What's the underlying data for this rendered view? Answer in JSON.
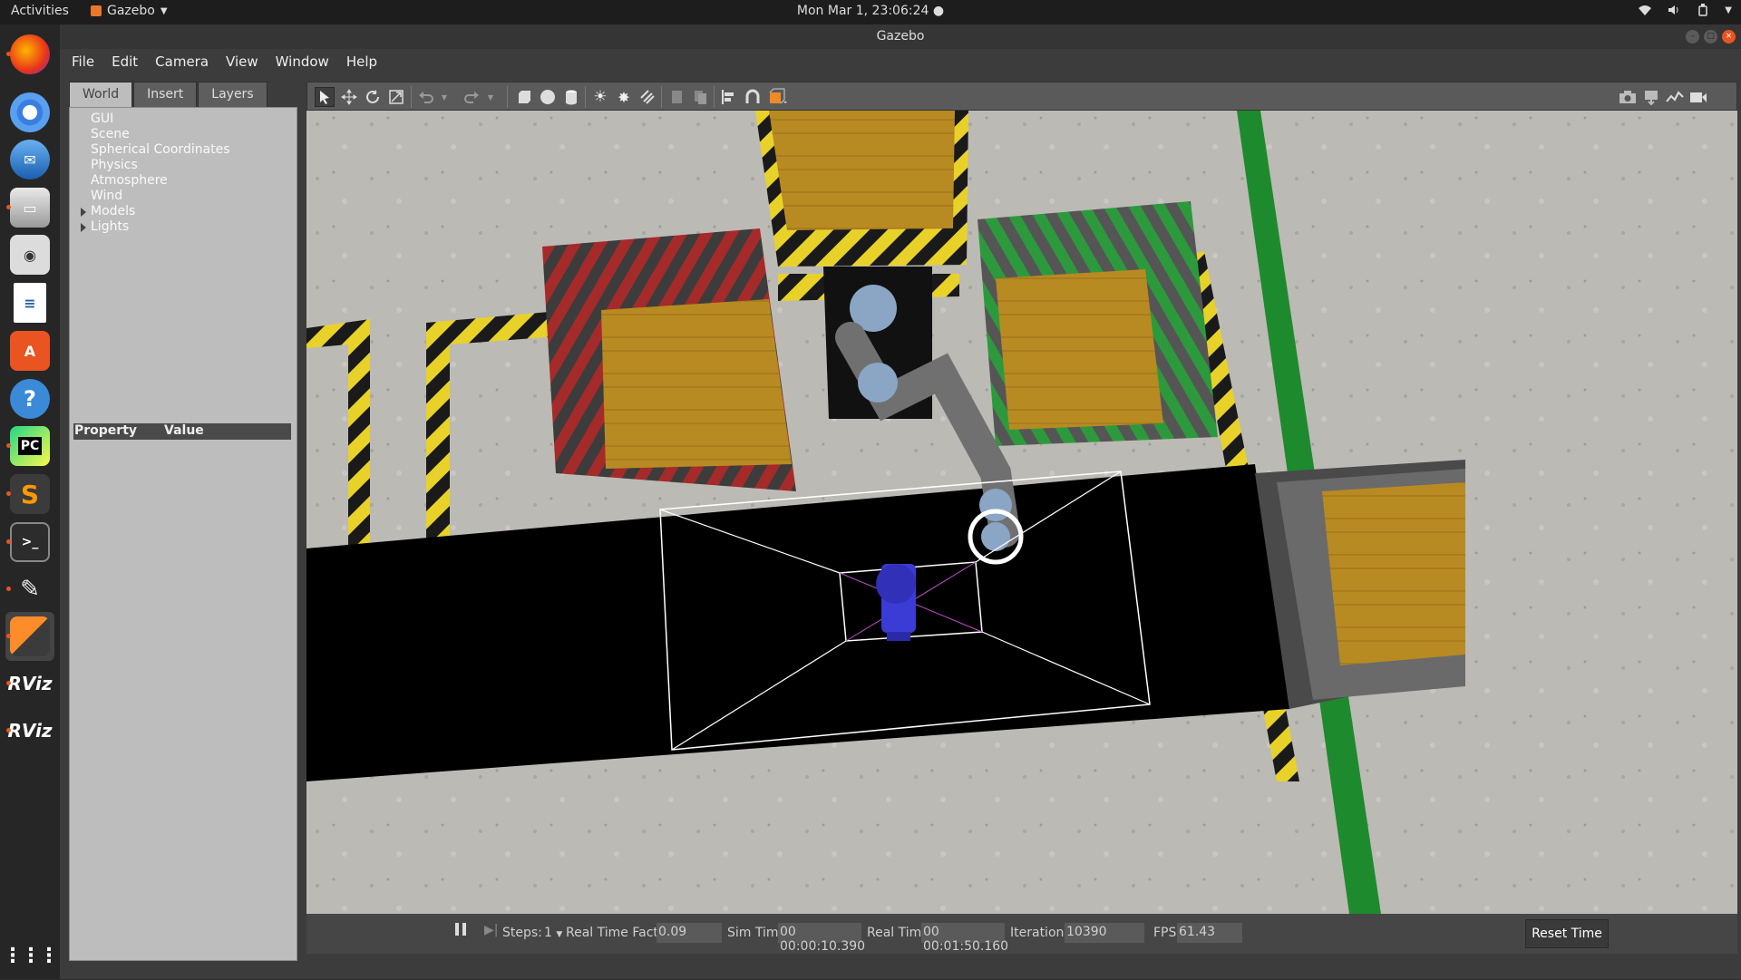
{
  "topbar": {
    "activities": "Activities",
    "app_name": "Gazebo",
    "clock": "Mon Mar  1, 23:06:24"
  },
  "window": {
    "title": "Gazebo"
  },
  "menu": [
    "File",
    "Edit",
    "Camera",
    "View",
    "Window",
    "Help"
  ],
  "tabs": [
    "World",
    "Insert",
    "Layers"
  ],
  "tree": {
    "items": [
      "GUI",
      "Scene",
      "Spherical Coordinates",
      "Physics",
      "Atmosphere",
      "Wind",
      "Models",
      "Lights"
    ]
  },
  "properties": {
    "col_property": "Property",
    "col_value": "Value"
  },
  "status": {
    "steps_label": "Steps:",
    "steps_value": "1",
    "rtf_label": "Real Time Factor:",
    "rtf_value": "0.09",
    "sim_label": "Sim Time:",
    "sim_value": "00 00:00:10.390",
    "real_label": "Real Time:",
    "real_value": "00 00:01:50.160",
    "iter_label": "Iterations:",
    "iter_value": "10390",
    "fps_label": "FPS:",
    "fps_value": "61.43",
    "reset_label": "Reset Time"
  },
  "dock": [
    "firefox-icon",
    "chromium-icon",
    "thunderbird-icon",
    "files-icon",
    "rhythmbox-icon",
    "writer-icon",
    "software-center-icon",
    "help-icon",
    "pycharm-icon",
    "sublime-icon",
    "terminal-icon",
    "gimp-icon",
    "gazebo-icon",
    "rviz-icon",
    "rviz-icon-2",
    "app-grid-icon"
  ],
  "dock_labels": {
    "pycharm": "PC",
    "rviz": "RViz",
    "rviz2": "RViz"
  },
  "colors": {
    "accent": "#e95420",
    "robot_blue": "#3b3bd6",
    "stripe_yellow": "#e8d22a",
    "stripe_green": "#2c9a3c",
    "stripe_red": "#a52a2a"
  }
}
